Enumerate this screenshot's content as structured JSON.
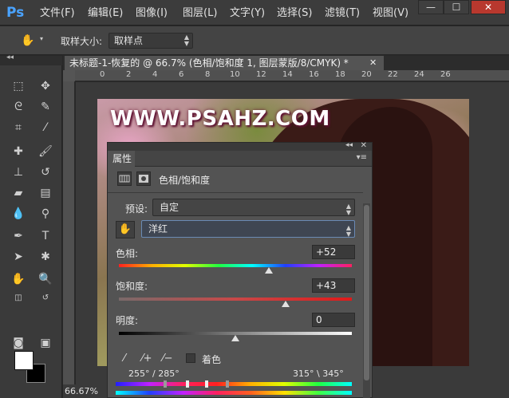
{
  "app": {
    "logo": "Ps"
  },
  "menu": {
    "items": [
      "文件(F)",
      "编辑(E)",
      "图像(I)",
      "图层(L)",
      "文字(Y)",
      "选择(S)",
      "滤镜(T)",
      "视图(V)"
    ]
  },
  "window_controls": {
    "minimize": "—",
    "maximize": "☐",
    "close": "✕"
  },
  "options_bar": {
    "sample_size_label": "取样大小:",
    "sample_size_value": "取样点"
  },
  "document": {
    "tab_title": "未标题-1-恢复的 @ 66.7% (色相/饱和度 1, 图层蒙版/8/CMYK) *",
    "tab_close": "✕",
    "ruler_ticks": [
      "0",
      "2",
      "4",
      "6",
      "8",
      "10",
      "12",
      "14",
      "16",
      "18",
      "20",
      "22",
      "24",
      "26"
    ],
    "watermark": "WWW.PSAHZ.COM",
    "zoom": "66.67%"
  },
  "properties": {
    "tab_label": "属性",
    "adjustment_title": "色相/饱和度",
    "preset_label": "预设:",
    "preset_value": "自定",
    "channel_value": "洋红",
    "hue_label": "色相:",
    "hue_value": "+52",
    "saturation_label": "饱和度:",
    "saturation_value": "+43",
    "lightness_label": "明度:",
    "lightness_value": "0",
    "colorize_label": "着色",
    "range_left": "255° / 285°",
    "range_right": "315° \\ 345°",
    "hue_level": 52,
    "saturation_level": 43,
    "lightness_level": 0
  },
  "colors": {
    "accent": "#6a8ab5",
    "foreground": "#ffffff",
    "background": "#000000"
  }
}
